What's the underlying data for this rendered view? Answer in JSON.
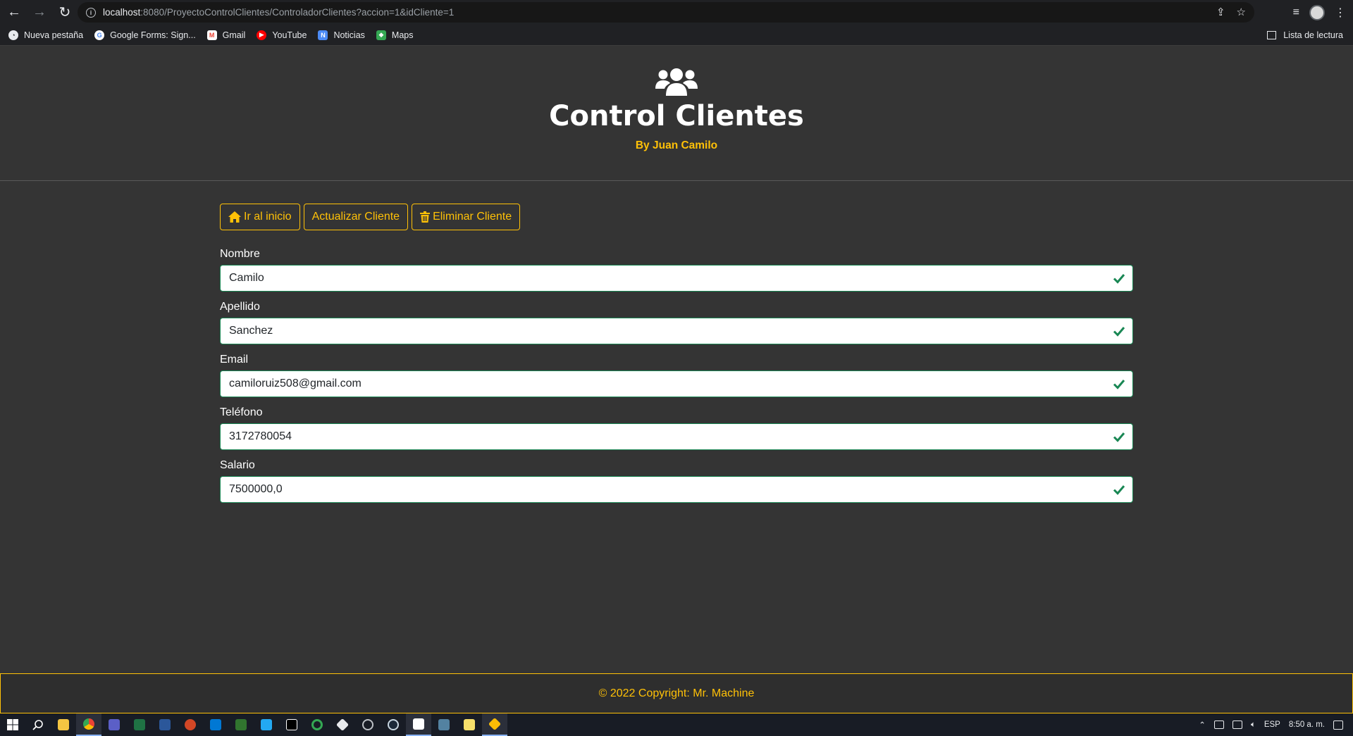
{
  "browser": {
    "url_host": "localhost",
    "url_rest": ":8080/ProyectoControlClientes/ControladorClientes?accion=1&idCliente=1",
    "bookmarks": [
      {
        "label": "Nueva pestaña",
        "icon": "new-tab-icon",
        "color": "#e8eaed"
      },
      {
        "label": "Google Forms: Sign...",
        "icon": "google-icon",
        "color": "#4285f4"
      },
      {
        "label": "Gmail",
        "icon": "gmail-icon",
        "color": "#ea4335"
      },
      {
        "label": "YouTube",
        "icon": "youtube-icon",
        "color": "#ff0000"
      },
      {
        "label": "Noticias",
        "icon": "news-icon",
        "color": "#4c8bf5"
      },
      {
        "label": "Maps",
        "icon": "maps-icon",
        "color": "#34a853"
      }
    ],
    "reading_list": "Lista de lectura"
  },
  "header": {
    "title": "Control Clientes",
    "subtitle": "By Juan Camilo"
  },
  "actions": {
    "home": "Ir al inicio",
    "update": "Actualizar Cliente",
    "delete": "Eliminar Cliente"
  },
  "form": {
    "nombre": {
      "label": "Nombre",
      "value": "Camilo"
    },
    "apellido": {
      "label": "Apellido",
      "value": "Sanchez"
    },
    "email": {
      "label": "Email",
      "value": "camiloruiz508@gmail.com"
    },
    "telefono": {
      "label": "Teléfono",
      "value": "3172780054"
    },
    "salario": {
      "label": "Salario",
      "value": "7500000,0"
    }
  },
  "footer": {
    "text": "© 2022 Copyright: Mr. Machine"
  },
  "taskbar": {
    "language": "ESP",
    "time": "8:50 a. m."
  },
  "colors": {
    "accent": "#ffc107",
    "valid": "#198754",
    "background": "#343434"
  }
}
